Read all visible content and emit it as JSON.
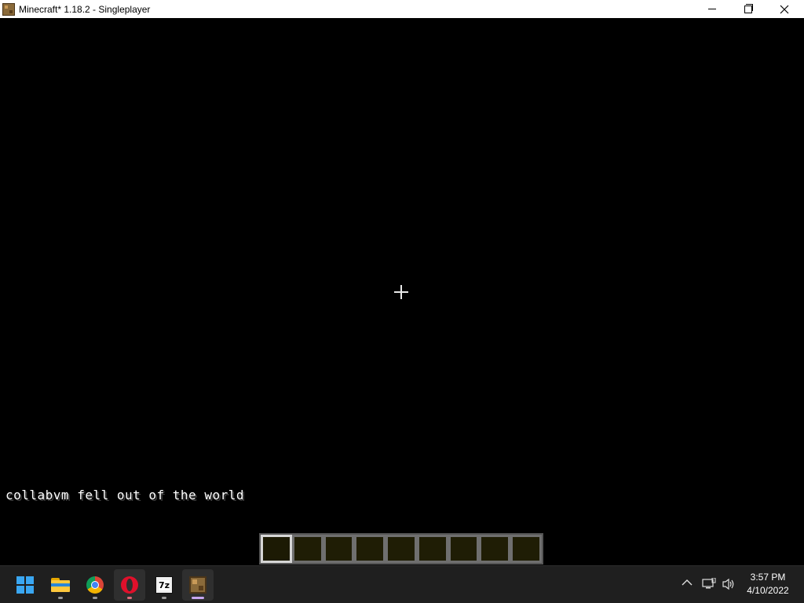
{
  "window": {
    "title": "Minecraft* 1.18.2 - Singleplayer",
    "icon": "minecraft-block-icon"
  },
  "game": {
    "chat_message": "collabvm fell out of the world",
    "hotbar": {
      "slot_count": 9,
      "selected_slot": 1
    }
  },
  "taskbar": {
    "apps": [
      {
        "name": "start",
        "icon": "windows-start-icon"
      },
      {
        "name": "file-explorer",
        "icon": "folder-icon"
      },
      {
        "name": "chrome",
        "icon": "chrome-icon"
      },
      {
        "name": "opera",
        "icon": "opera-icon"
      },
      {
        "name": "7zip",
        "icon": "7zip-icon",
        "label": "7z"
      },
      {
        "name": "minecraft",
        "icon": "minecraft-icon",
        "active": true
      }
    ],
    "tray": {
      "chevron": "^",
      "network": "network-icon",
      "volume": "volume-icon"
    },
    "clock": {
      "time": "3:57 PM",
      "date": "4/10/2022"
    }
  },
  "colors": {
    "taskbar_bg": "#1f1f1f",
    "active_indicator": "#c7a6f0",
    "game_bg": "#000000"
  }
}
